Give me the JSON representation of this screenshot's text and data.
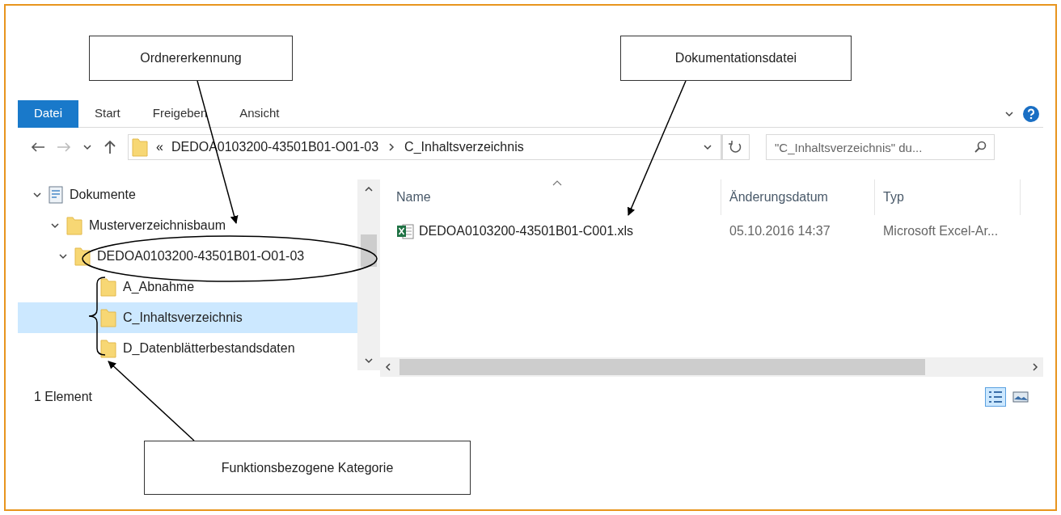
{
  "ribbon": {
    "tabs": [
      {
        "label": "Datei",
        "selected": true
      },
      {
        "label": "Start",
        "selected": false
      },
      {
        "label": "Freigeben",
        "selected": false
      },
      {
        "label": "Ansicht",
        "selected": false
      }
    ]
  },
  "address_bar": {
    "overflow": "«",
    "segments": [
      "DEDOA0103200-43501B01-O01-03",
      "C_Inhaltsverzeichnis"
    ]
  },
  "search": {
    "placeholder": "\"C_Inhaltsverzeichnis\" du..."
  },
  "navigation_tree": [
    {
      "label": "Dokumente",
      "kind": "library",
      "expanded": true,
      "selected": false,
      "children": [
        {
          "label": "Musterverzeichnisbaum",
          "kind": "folder",
          "expanded": true,
          "selected": false,
          "children": [
            {
              "label": "DEDOA0103200-43501B01-O01-03",
              "kind": "folder",
              "expanded": true,
              "selected": false,
              "children": [
                {
                  "label": "A_Abnahme",
                  "kind": "folder",
                  "selected": false
                },
                {
                  "label": "C_Inhaltsverzeichnis",
                  "kind": "folder",
                  "selected": true
                },
                {
                  "label": "D_Datenblätterbestandsdaten",
                  "kind": "folder",
                  "selected": false
                }
              ]
            }
          ]
        }
      ]
    }
  ],
  "file_list": {
    "columns": [
      "Name",
      "Änderungsdatum",
      "Typ"
    ],
    "rows": [
      {
        "kind": "excel",
        "name": "DEDOA0103200-43501B01-C001.xls",
        "modified": "05.10.2016 14:37",
        "type": "Microsoft Excel-Ar..."
      }
    ]
  },
  "status_bar": "1 Element",
  "annotations": [
    {
      "text": "Ordnererkennung"
    },
    {
      "text": "Dokumentationsdatei"
    },
    {
      "text": "Funktionsbezogene Kategorie"
    }
  ]
}
